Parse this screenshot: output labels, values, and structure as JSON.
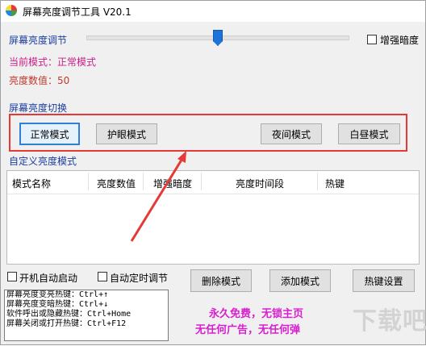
{
  "window": {
    "title": "屏幕亮度调节工具 V20.1"
  },
  "brightness": {
    "label": "屏幕亮度调节",
    "level_percent": 50,
    "enhance_label": "增强暗度"
  },
  "status": {
    "mode_text": "当前模式：正常模式",
    "value_text": "亮度数值：50"
  },
  "mode_switch": {
    "label": "屏幕亮度切换",
    "buttons": [
      "正常模式",
      "护眼模式",
      "夜间模式",
      "白昼模式"
    ]
  },
  "custom": {
    "label": "自定义亮度模式",
    "columns": [
      "模式名称",
      "亮度数值",
      "增强暗度",
      "亮度时间段",
      "热键"
    ]
  },
  "options": {
    "autostart_label": "开机自动启动",
    "auto_timer_label": "自动定时调节"
  },
  "actions": {
    "delete_label": "删除模式",
    "add_label": "添加模式",
    "hotkey_label": "热键设置"
  },
  "hotkeys": [
    "屏幕亮度变亮热键：Ctrl+↑",
    "屏幕亮度变暗热键：Ctrl+↓",
    "软件呼出或隐藏热键：Ctrl+Home",
    "屏幕关闭或打开热键：Ctrl+F12"
  ],
  "promo": {
    "line1": "永久免费，无锁主页",
    "line2": "无任何广告，无任何弹"
  },
  "watermark": "下载吧",
  "colors": {
    "accent": "#1e73d8",
    "highlight_box": "#e53935",
    "promo": "#d81fd0"
  }
}
